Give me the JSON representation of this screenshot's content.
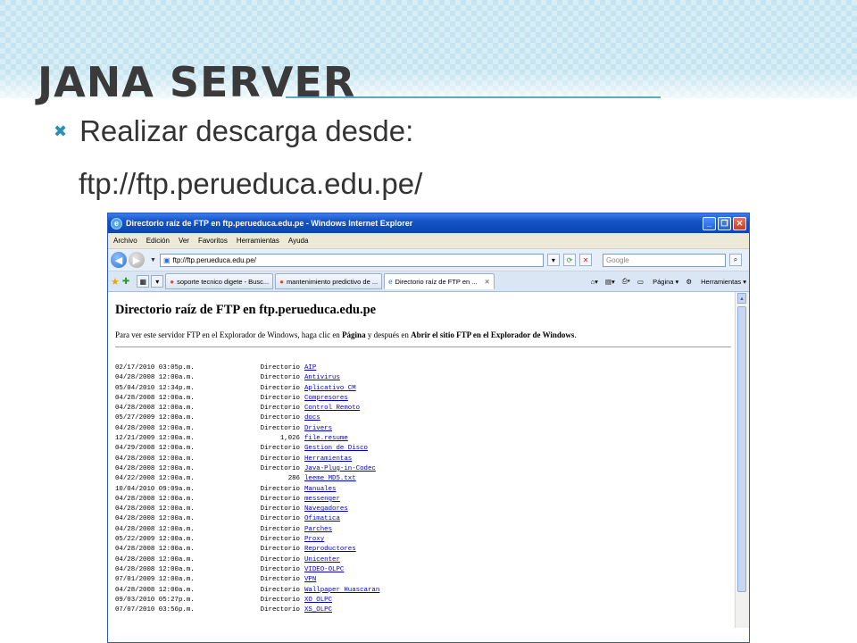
{
  "slide": {
    "title": "JANA SERVER",
    "bullet": "Realizar descarga desde:",
    "url": "ftp://ftp.perueduca.edu.pe/"
  },
  "window": {
    "title": "Directorio raíz de FTP en ftp.perueduca.edu.pe - Windows Internet Explorer",
    "menu": [
      "Archivo",
      "Edición",
      "Ver",
      "Favoritos",
      "Herramientas",
      "Ayuda"
    ],
    "address": "ftp://ftp.perueduca.edu.pe/",
    "search_placeholder": "Google",
    "tabs": [
      {
        "label": "soporte tecnico digete - Busc...",
        "active": false
      },
      {
        "label": "mantenimiento predictivo de ...",
        "active": false
      },
      {
        "label": "Directorio raíz de FTP en ...",
        "active": true
      }
    ],
    "commands": {
      "page": "Página",
      "tools": "Herramientas"
    }
  },
  "page": {
    "heading": "Directorio raíz de FTP en ftp.perueduca.edu.pe",
    "intro_prefix": "Para ver este servidor FTP en el Explorador de Windows, haga clic en ",
    "intro_page": "Página",
    "intro_middle": " y después en ",
    "intro_action": "Abrir el sitio FTP en el Explorador de Windows",
    "intro_suffix": ".",
    "listing": [
      {
        "date": "02/17/2010 03:05p.m.",
        "type": "Directorio",
        "name": "AIP"
      },
      {
        "date": "04/28/2008 12:00a.m.",
        "type": "Directorio",
        "name": "Antivirus"
      },
      {
        "date": "05/04/2010 12:34p.m.",
        "type": "Directorio",
        "name": "Aplicativo CM"
      },
      {
        "date": "04/28/2008 12:00a.m.",
        "type": "Directorio",
        "name": "Compresores"
      },
      {
        "date": "04/28/2008 12:00a.m.",
        "type": "Directorio",
        "name": "Control Remoto"
      },
      {
        "date": "05/27/2009 12:00a.m.",
        "type": "Directorio",
        "name": "docs"
      },
      {
        "date": "04/28/2008 12:00a.m.",
        "type": "Directorio",
        "name": "Drivers"
      },
      {
        "date": "12/21/2009 12:00a.m.",
        "type": "1,026",
        "name": "file.resume"
      },
      {
        "date": "04/29/2008 12:00a.m.",
        "type": "Directorio",
        "name": "Gestion de Disco"
      },
      {
        "date": "04/28/2008 12:00a.m.",
        "type": "Directorio",
        "name": "Herramientas"
      },
      {
        "date": "04/28/2008 12:00a.m.",
        "type": "Directorio",
        "name": "Java-Plug-in-Codec"
      },
      {
        "date": "04/22/2008 12:00a.m.",
        "type": "286",
        "name": "leeme MD5.txt"
      },
      {
        "date": "10/04/2010 09:09a.m.",
        "type": "Directorio",
        "name": "Manuales"
      },
      {
        "date": "04/28/2008 12:00a.m.",
        "type": "Directorio",
        "name": "messenger"
      },
      {
        "date": "04/28/2008 12:00a.m.",
        "type": "Directorio",
        "name": "Navegadores"
      },
      {
        "date": "04/28/2008 12:00a.m.",
        "type": "Directorio",
        "name": "Ofimatica"
      },
      {
        "date": "04/28/2008 12:00a.m.",
        "type": "Directorio",
        "name": "Parches"
      },
      {
        "date": "05/22/2009 12:00a.m.",
        "type": "Directorio",
        "name": "Proxy"
      },
      {
        "date": "04/28/2008 12:00a.m.",
        "type": "Directorio",
        "name": "Reproductores"
      },
      {
        "date": "04/28/2008 12:00a.m.",
        "type": "Directorio",
        "name": "Unicenter"
      },
      {
        "date": "04/28/2008 12:00a.m.",
        "type": "Directorio",
        "name": "VIDEO-OLPC"
      },
      {
        "date": "07/01/2009 12:00a.m.",
        "type": "Directorio",
        "name": "VPN"
      },
      {
        "date": "04/28/2008 12:00a.m.",
        "type": "Directorio",
        "name": "Wallpaper Huascaran"
      },
      {
        "date": "09/03/2010 05:27p.m.",
        "type": "Directorio",
        "name": "XO OLPC"
      },
      {
        "date": "07/07/2010 03:56p.m.",
        "type": "Directorio",
        "name": "XS_OLPC"
      }
    ]
  },
  "colors": {
    "accent": "#2d8fb5",
    "link": "#0000cc",
    "titlebar": "#1553c6"
  }
}
